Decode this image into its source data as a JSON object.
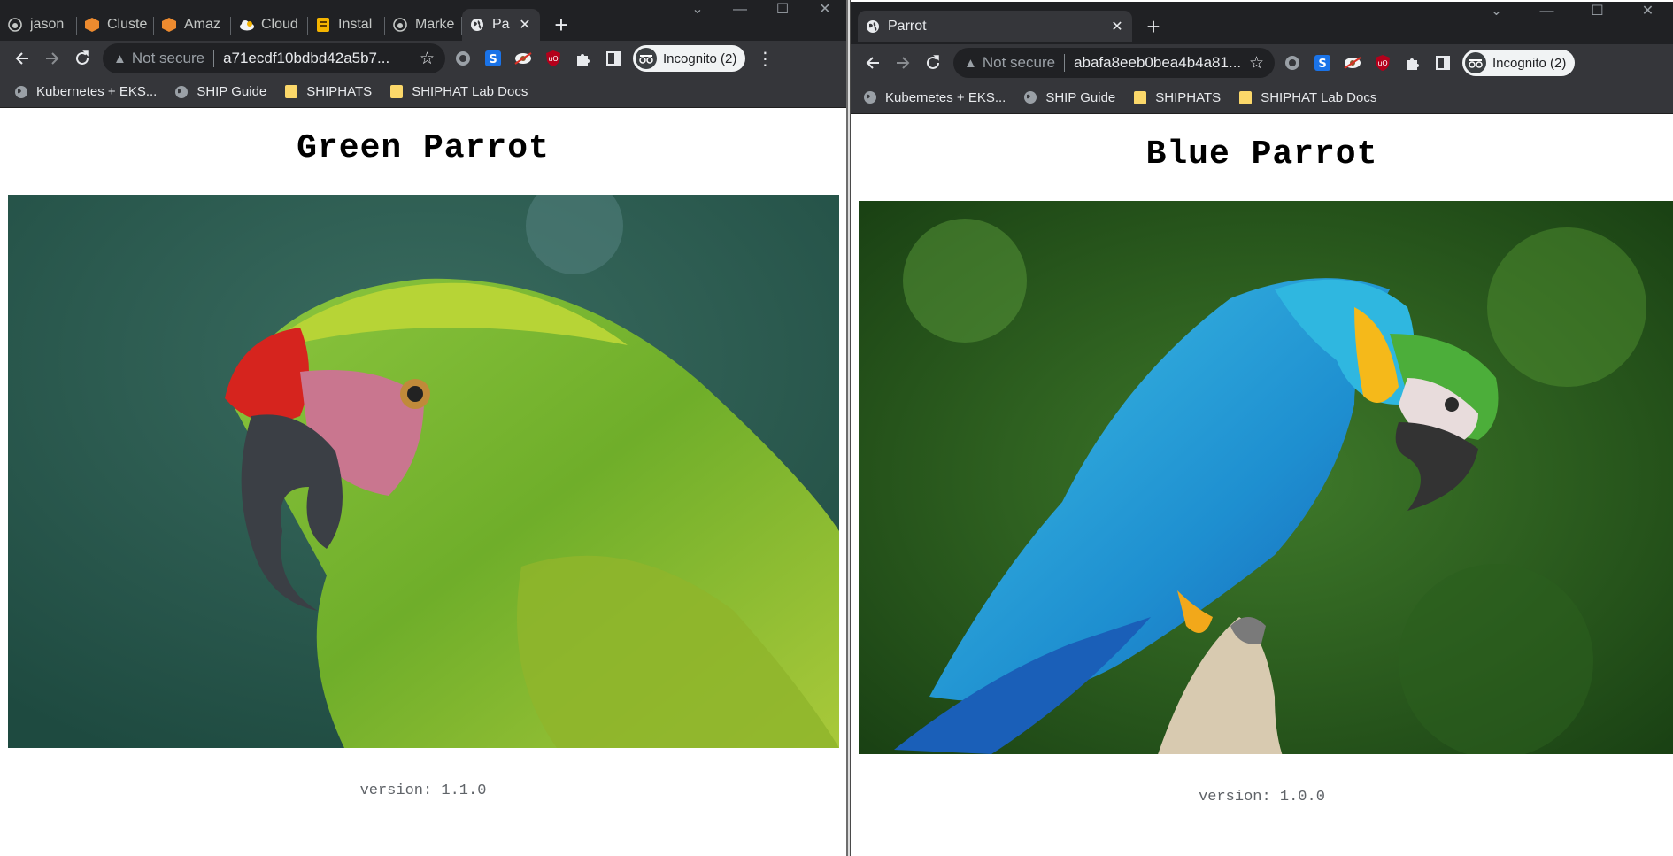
{
  "left_window": {
    "tabs": [
      {
        "label": "jason",
        "icon": "github-icon"
      },
      {
        "label": "Cluste",
        "icon": "aws-orange-icon"
      },
      {
        "label": "Amaz",
        "icon": "aws-orange-icon"
      },
      {
        "label": "Cloud",
        "icon": "cloud-icon"
      },
      {
        "label": "Instal",
        "icon": "docs-icon"
      },
      {
        "label": "Marke",
        "icon": "github-icon"
      }
    ],
    "active_tab": {
      "label": "Pa",
      "icon": "globe-icon",
      "close": "✕"
    },
    "new_tab": "+",
    "omnibox": {
      "warning": "Not secure",
      "url": "a71ecdf10bdbd42a5b7..."
    },
    "incognito": "Incognito (2)",
    "bookmarks": [
      "Kubernetes + EKS...",
      "SHIP Guide",
      "SHIPHATS",
      "SHIPHAT Lab Docs"
    ],
    "page": {
      "heading": "Green Parrot",
      "version": "version: 1.1.0"
    }
  },
  "right_window": {
    "active_tab": {
      "label": "Parrot",
      "icon": "globe-icon",
      "close": "✕"
    },
    "new_tab": "+",
    "omnibox": {
      "warning": "Not secure",
      "url": "abafa8eeb0bea4b4a81..."
    },
    "incognito": "Incognito (2)",
    "bookmarks": [
      "Kubernetes + EKS...",
      "SHIP Guide",
      "SHIPHATS",
      "SHIPHAT Lab Docs"
    ],
    "page": {
      "heading": "Blue Parrot",
      "version": "version: 1.0.0"
    }
  },
  "window_controls": {
    "chevron": "⌄",
    "minimize": "—",
    "maximize": "☐",
    "close": "✕"
  },
  "colors": {
    "chrome_dark": "#202124",
    "toolbar": "#35363a",
    "omnibox": "#202124",
    "bookmark_folder": "#fbd86a"
  }
}
